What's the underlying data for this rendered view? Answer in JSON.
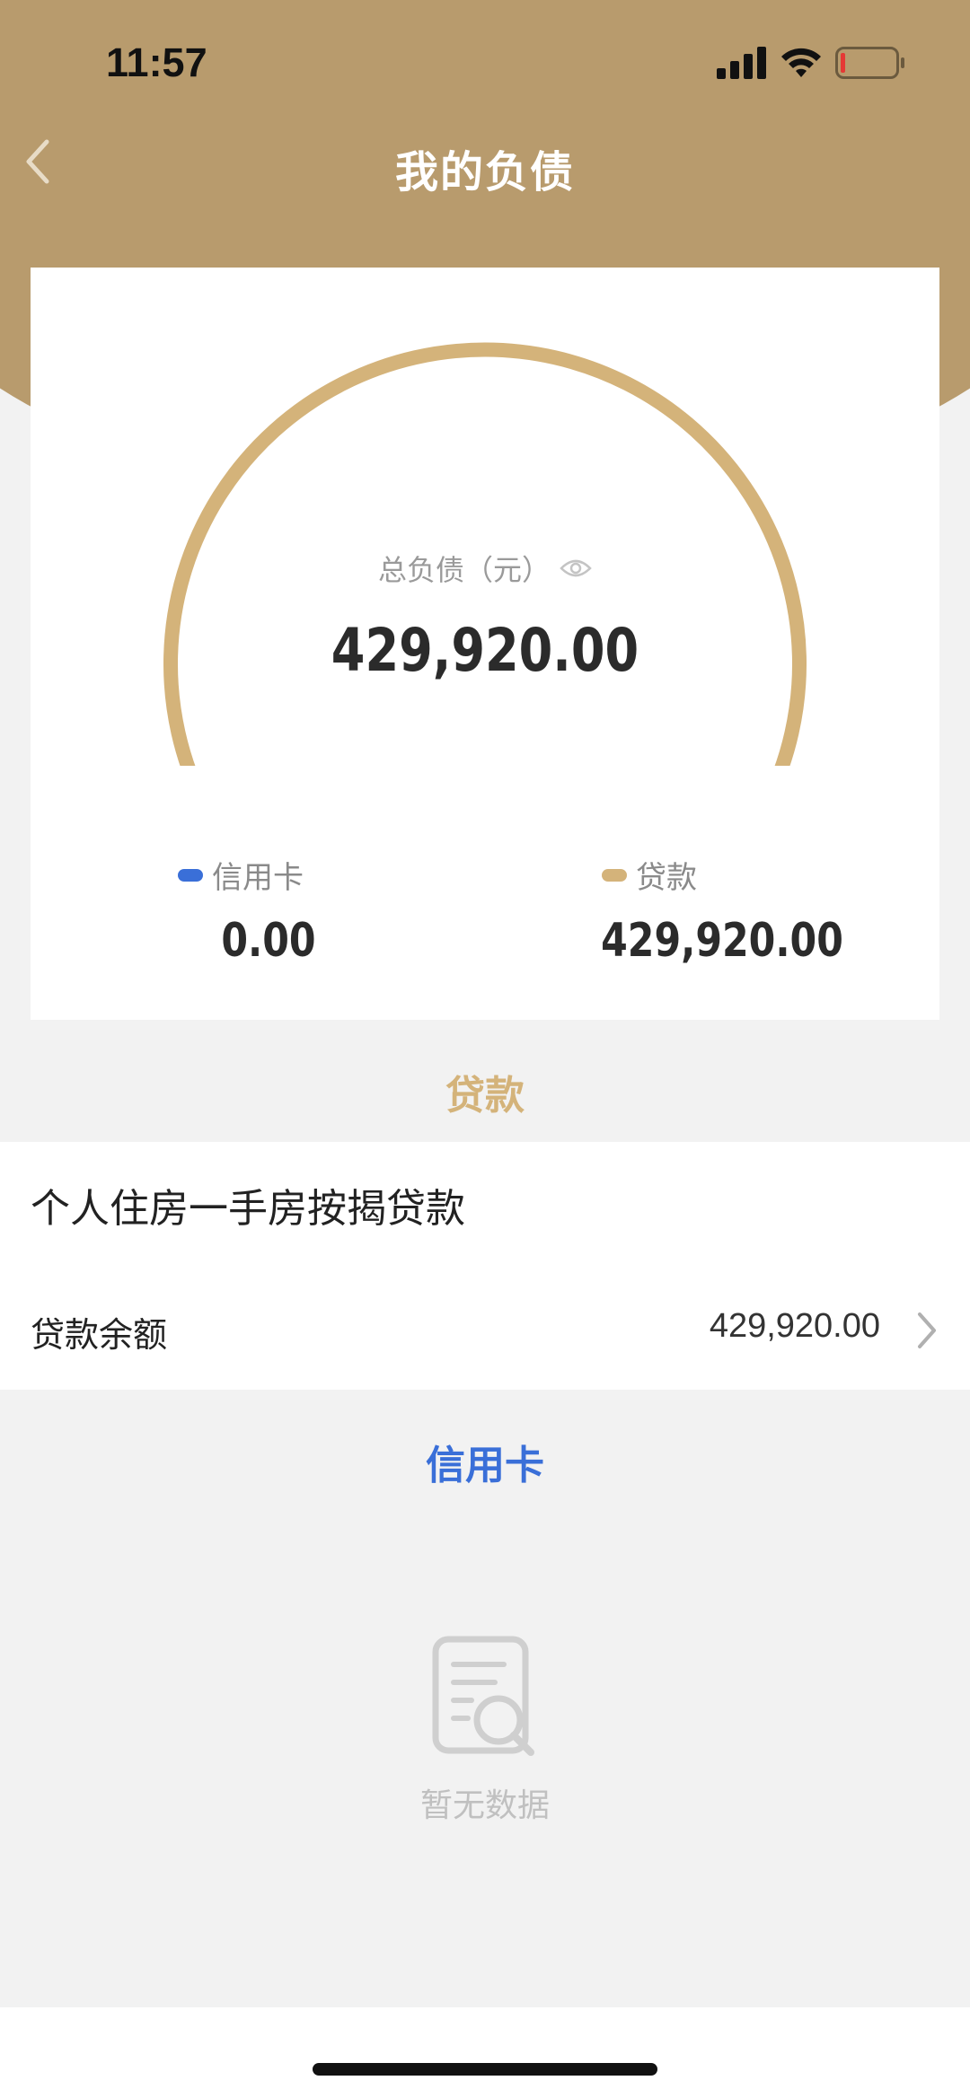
{
  "status_bar": {
    "time": "11:57"
  },
  "nav": {
    "title": "我的负债",
    "back_icon": "chevron-left-icon"
  },
  "summary": {
    "total_label": "总负债（元）",
    "total_amount": "429,920.00",
    "visibility_icon": "eye-icon",
    "credit_card_label": "信用卡",
    "credit_card_value": "0.00",
    "loan_label": "贷款",
    "loan_value": "429,920.00"
  },
  "loan_section": {
    "title": "贷款",
    "item_name": "个人住房一手房按揭贷款",
    "balance_label": "贷款余额",
    "balance_value": "429,920.00"
  },
  "credit_section": {
    "title": "信用卡",
    "empty_text": "暂无数据"
  },
  "colors": {
    "header_bg": "#b89b6d",
    "loan_accent": "#d4b37a",
    "credit_accent": "#3a6fd8",
    "card_bg": "#ffffff",
    "page_bg": "#f2f2f2"
  }
}
